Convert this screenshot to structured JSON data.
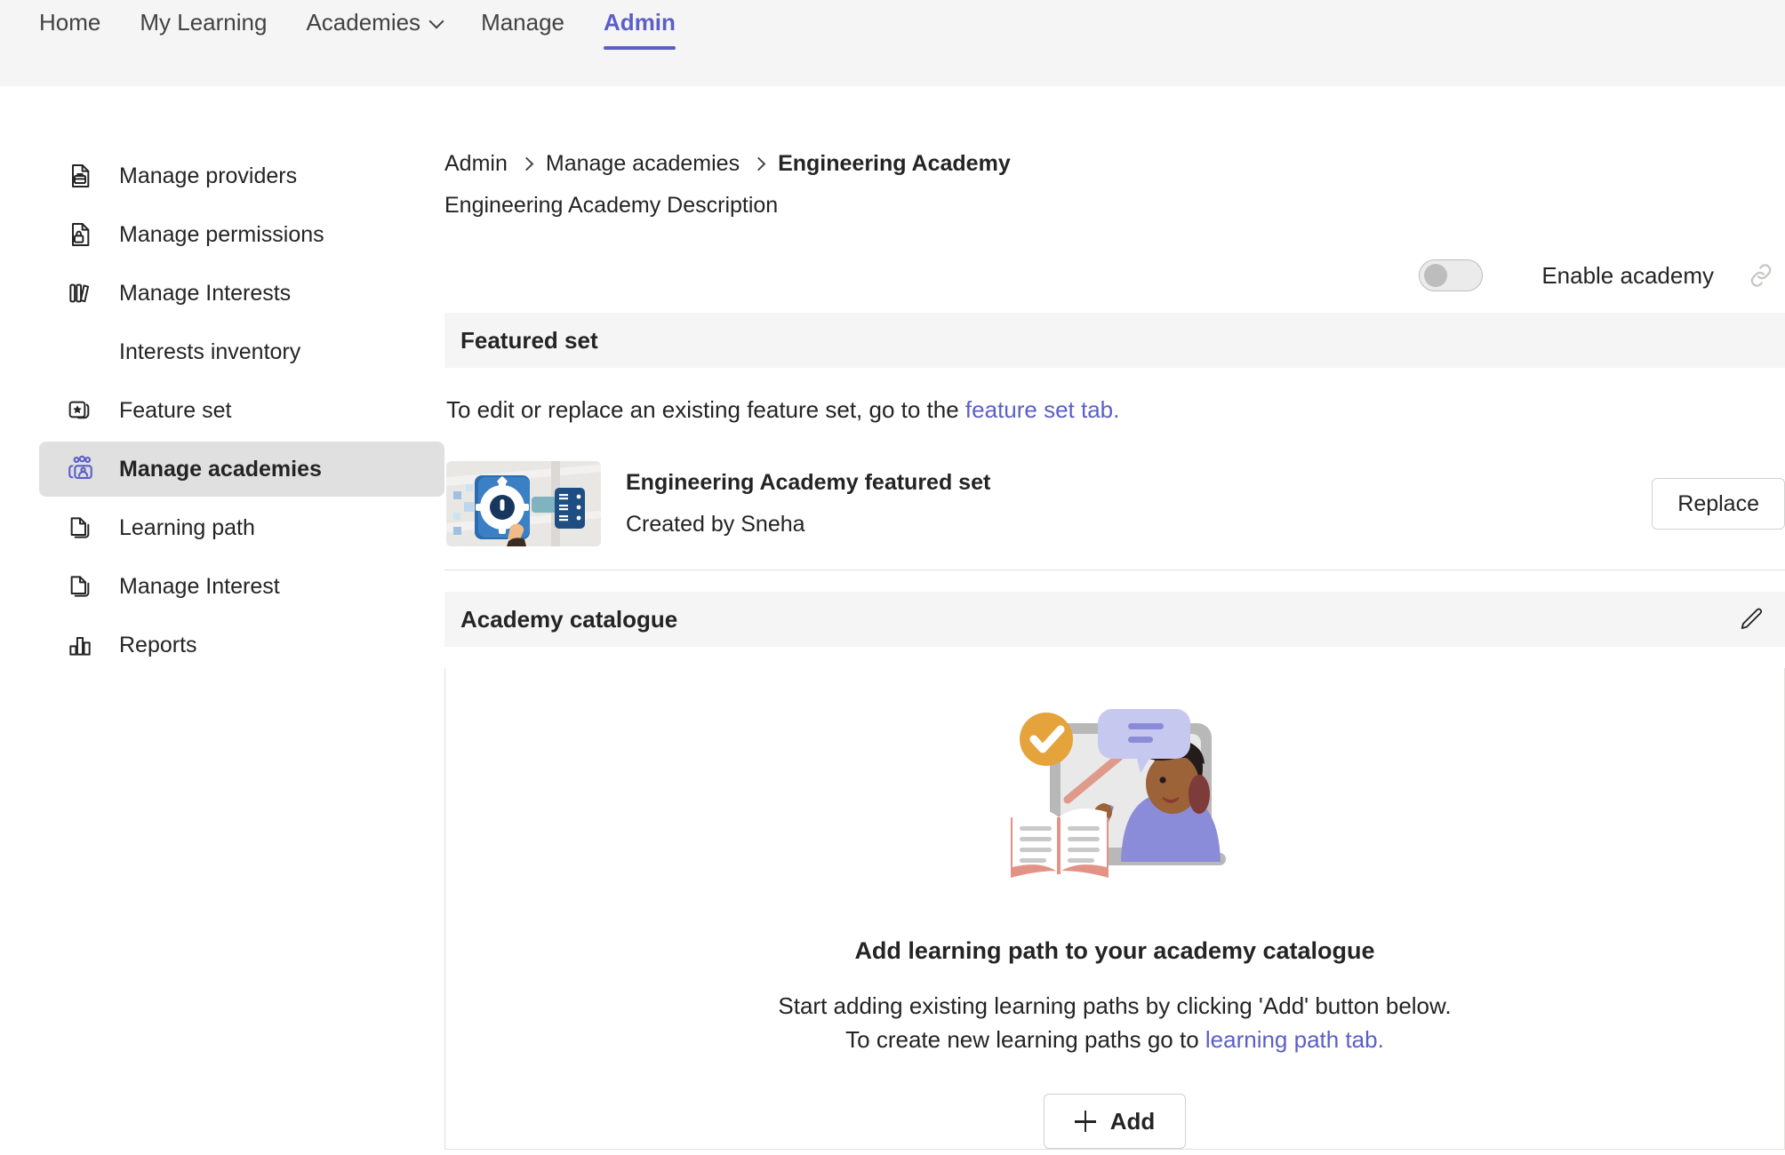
{
  "topnav": {
    "items": [
      {
        "label": "Home",
        "active": false,
        "caret": false
      },
      {
        "label": "My Learning",
        "active": false,
        "caret": false
      },
      {
        "label": "Academies",
        "active": false,
        "caret": true
      },
      {
        "label": "Manage",
        "active": false,
        "caret": false
      },
      {
        "label": "Admin",
        "active": true,
        "caret": false
      }
    ]
  },
  "sidebar": {
    "items": [
      {
        "label": "Manage providers",
        "icon": "toolbox-document-icon",
        "selected": false,
        "sub": false
      },
      {
        "label": "Manage permissions",
        "icon": "lock-document-icon",
        "selected": false,
        "sub": false
      },
      {
        "label": "Manage Interests",
        "icon": "books-icon",
        "selected": false,
        "sub": false
      },
      {
        "label": "Interests inventory",
        "icon": "",
        "selected": false,
        "sub": true
      },
      {
        "label": "Feature set",
        "icon": "star-stack-icon",
        "selected": false,
        "sub": false
      },
      {
        "label": "Manage academies",
        "icon": "people-teacher-icon",
        "selected": true,
        "sub": false
      },
      {
        "label": "Learning path",
        "icon": "documents-icon",
        "selected": false,
        "sub": false
      },
      {
        "label": "Manage Interest",
        "icon": "documents-icon",
        "selected": false,
        "sub": false
      },
      {
        "label": "Reports",
        "icon": "bar-chart-icon",
        "selected": false,
        "sub": false
      }
    ]
  },
  "breadcrumb": {
    "crumb1": "Admin",
    "crumb2": "Manage academies",
    "crumb3": "Engineering Academy"
  },
  "page": {
    "subtitle": "Engineering Academy Description"
  },
  "enable_academy": {
    "label": "Enable academy",
    "state": "off",
    "link_icon": "link-icon"
  },
  "featured_set": {
    "section_title": "Featured set",
    "helper_prefix": "To edit or replace an existing feature set, go to the ",
    "helper_link": "feature set tab.",
    "item_title": "Engineering Academy featured set",
    "item_created_by": "Created by Sneha",
    "replace_label": "Replace"
  },
  "academy_catalogue": {
    "section_title": "Academy catalogue",
    "edit_icon": "pencil-icon",
    "empty_illustration": "teacher-laptop-illustration",
    "empty_title": "Add learning path to your academy catalogue",
    "empty_line1": "Start adding existing learning paths by clicking 'Add' button below.",
    "empty_line2_prefix": "To create new learning paths go to ",
    "empty_line2_link": "learning path tab.",
    "add_label": "Add"
  },
  "colors": {
    "accent": "#5b5fc7",
    "link": "#5b5fc7",
    "section_bg": "#f5f5f5",
    "selected_bg": "#e0e0e0",
    "text": "#242424"
  }
}
